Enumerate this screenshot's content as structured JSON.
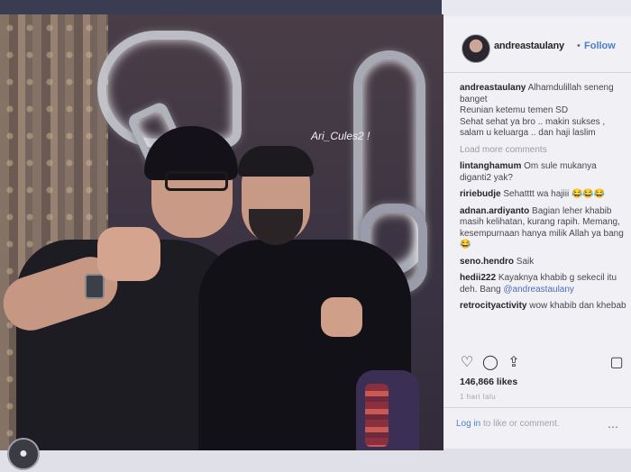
{
  "post": {
    "overlay_caption": "Ari_Cules2 !",
    "header_username": "andreastaulany",
    "header_dot": "•",
    "follow_label": "Follow"
  },
  "comments": [
    {
      "user": "andreastaulany",
      "text": "Alhamdulillah seneng banget\nReunian ketemu temen SD\nSehat sehat ya bro .. makin sukses , salam u keluarga .. dan haji laslim"
    },
    {
      "user": "lintanghamum",
      "text": "Om sule mukanya diganti2 yak?"
    },
    {
      "user": "ririebudje",
      "text": "Sehatttt wa hajiii 😂😂😂"
    },
    {
      "user": "adnan.ardiyanto",
      "text": "Bagian leher khabib masih kelihatan, kurang rapih. Memang, kesempurnaan hanya milik Allah ya bang 😂"
    },
    {
      "user": "seno.hendro",
      "text": "Saik"
    },
    {
      "user": "hedii222",
      "text": "Kayaknya khabib g sekecil itu deh. Bang",
      "mention": "@andreastaulany"
    },
    {
      "user": "retrocityactivity",
      "text": "wow khabib dan khebab"
    }
  ],
  "load_more": "Load more comments",
  "likes": "146,866 likes",
  "date": "1 hari lalu",
  "login": {
    "link": "Log in",
    "rest": "to like or comment."
  },
  "icons": {
    "like": "heart-icon",
    "comment": "comment-icon",
    "share": "share-icon",
    "save": "bookmark-icon",
    "more": "more-dots-icon",
    "profile": "profile-icon"
  },
  "colors": {
    "link": "#4a7fd4",
    "text": "#262626",
    "muted": "#9b9ba3"
  }
}
